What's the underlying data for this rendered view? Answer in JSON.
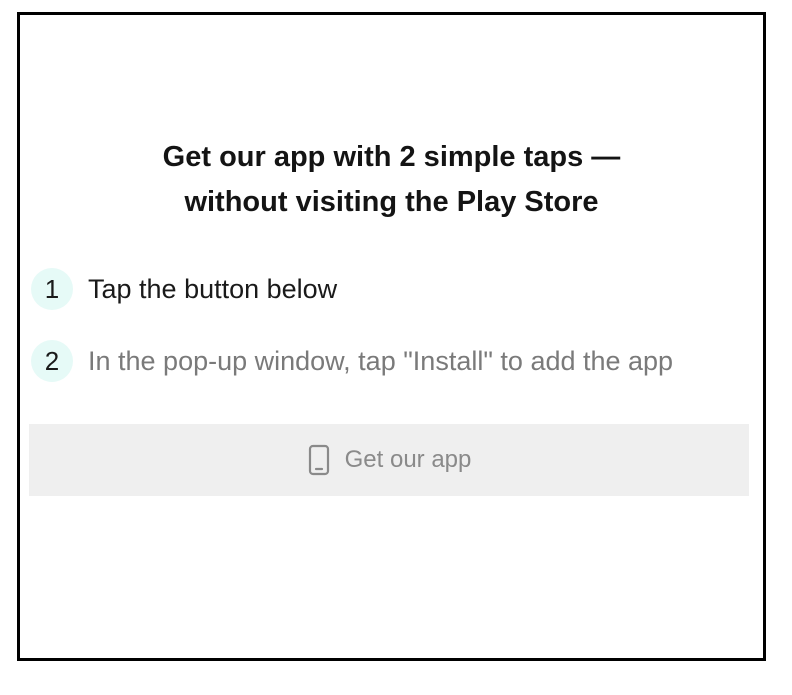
{
  "dialog": {
    "title_line1": "Get our app with 2 simple taps —",
    "title_line2": "without visiting the Play Store",
    "steps": [
      {
        "number": "1",
        "text": "Tap the button below"
      },
      {
        "number": "2",
        "text": "In the pop-up window, tap \"Install\" to add the app"
      }
    ],
    "button": {
      "label": "Get our app",
      "icon": "phone-icon"
    }
  }
}
